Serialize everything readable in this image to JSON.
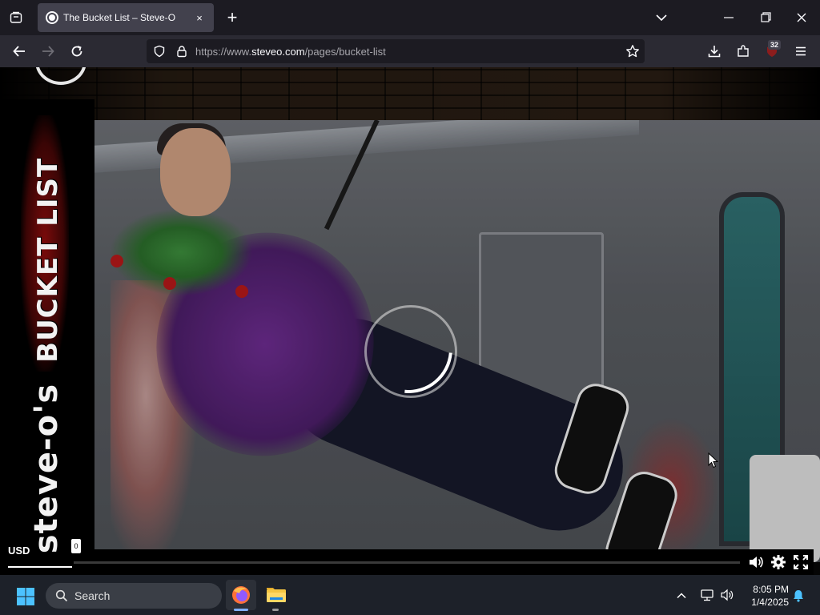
{
  "browser": {
    "tab": {
      "title": "The Bucket List – Steve-O",
      "close_label": "×"
    },
    "new_tab_label": "+",
    "url": {
      "prefix": "https://www.",
      "host": "steveo.com",
      "path": "/pages/bucket-list"
    },
    "extension_badge": "32"
  },
  "page": {
    "side_title": {
      "bucket": "BUCKET LIST",
      "steveo": "steve-o's"
    },
    "video": {
      "state": "loading",
      "controls": {
        "volume": "volume-icon",
        "settings": "gear-icon",
        "fullscreen": "fullscreen-icon"
      }
    },
    "currency": "USD",
    "mini_badge": "0"
  },
  "taskbar": {
    "search_placeholder": "Search",
    "time": "8:05 PM",
    "date": "1/4/2025"
  },
  "colors": {
    "tabstrip": "#1c1b22",
    "navbar": "#2b2a33",
    "taskbar": "#1d2129",
    "accent": "#7fb0ff"
  }
}
